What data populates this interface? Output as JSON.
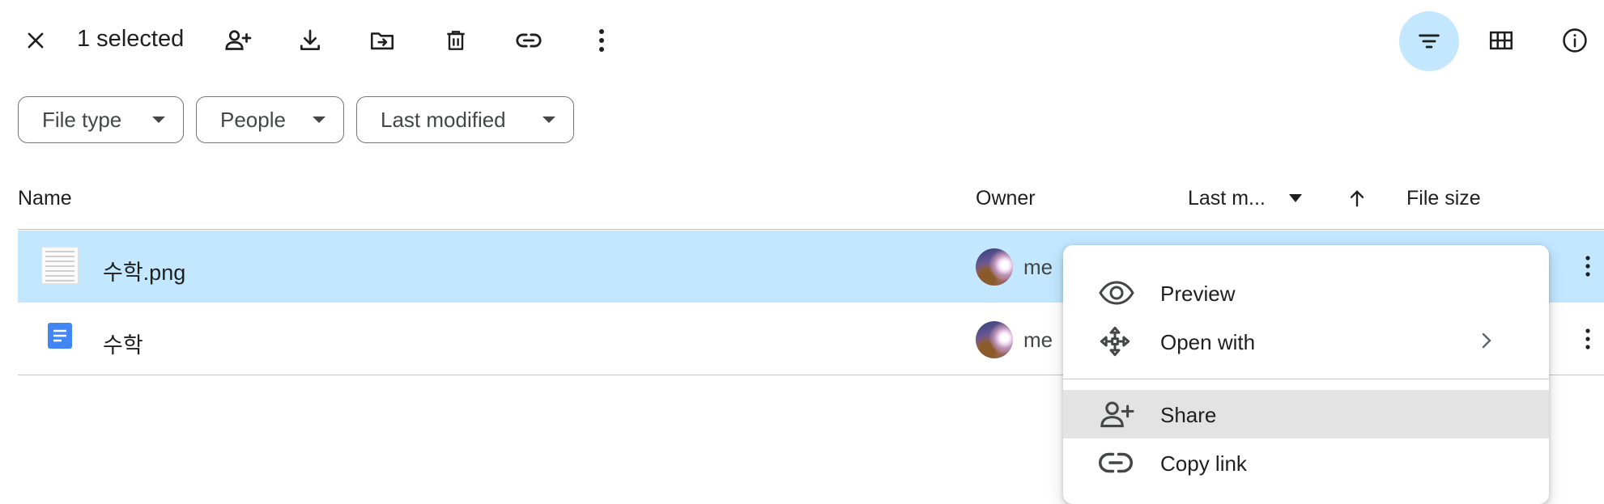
{
  "toolbar": {
    "selected_text": "1 selected",
    "icons": [
      "close-icon",
      "add-person-icon",
      "download-icon",
      "move-to-folder-icon",
      "trash-icon",
      "link-icon",
      "more-vert-icon",
      "filter-icon",
      "grid-view-icon",
      "info-icon"
    ]
  },
  "filters": {
    "file_type": "File type",
    "people": "People",
    "last_modified": "Last modified"
  },
  "columns": {
    "name": "Name",
    "owner": "Owner",
    "last_modified": "Last m...",
    "file_size": "File size"
  },
  "files": [
    {
      "name": "수학.png",
      "owner": "me",
      "selected": true,
      "type": "image"
    },
    {
      "name": "수학",
      "owner": "me",
      "selected": false,
      "type": "google-doc"
    }
  ],
  "context_menu": {
    "items": [
      {
        "label": "Preview",
        "icon": "eye-icon"
      },
      {
        "label": "Open with",
        "icon": "move-arrows-icon",
        "submenu": true
      },
      {
        "label": "Share",
        "icon": "add-person-icon",
        "highlighted": true
      },
      {
        "label": "Copy link",
        "icon": "link-icon"
      }
    ]
  },
  "colors": {
    "selection": "#c2e7ff",
    "menu_hover": "#e3e3e3",
    "doc_blue": "#4285f4"
  }
}
